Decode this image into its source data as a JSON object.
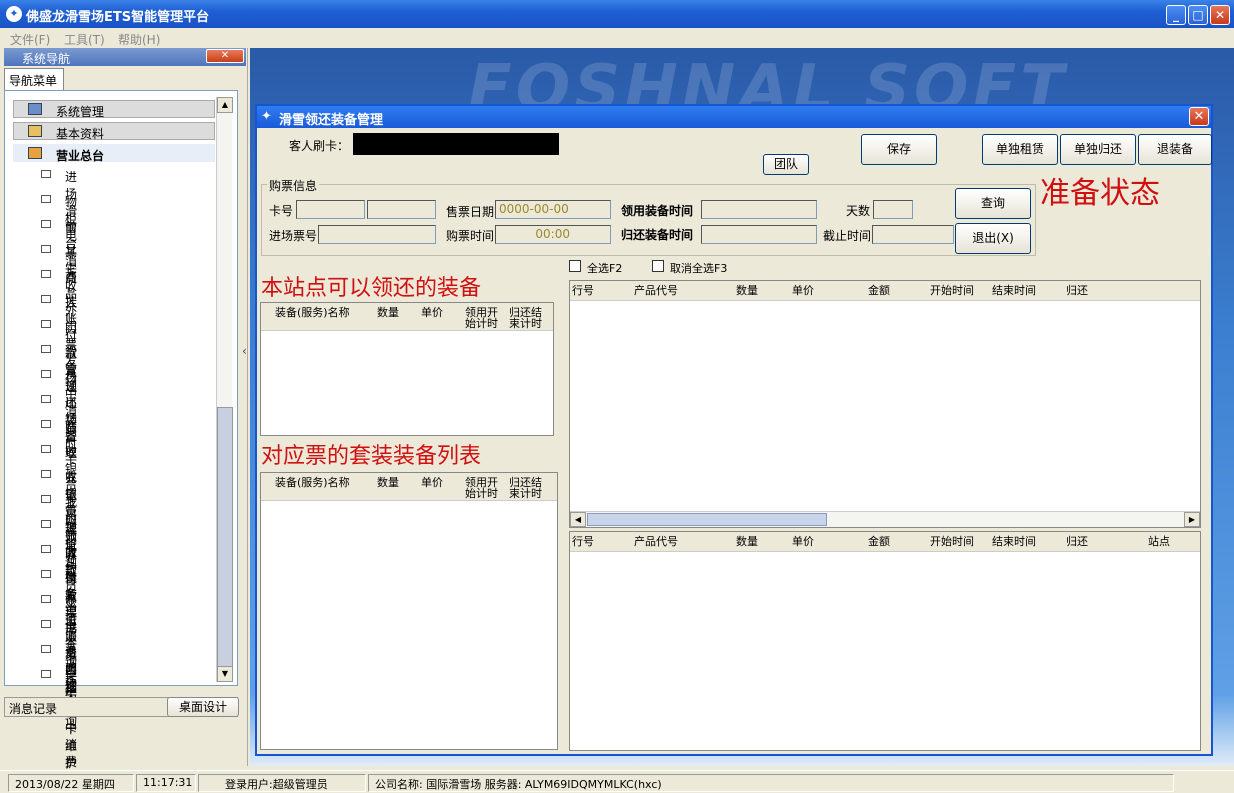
{
  "window": {
    "title": "佛盛龙滑雪场ETS智能管理平台"
  },
  "menu": [
    "文件(F)",
    "工具(T)",
    "帮助(H)"
  ],
  "nav": {
    "header": "系统导航",
    "tab": "导航菜单",
    "groups": [
      "系统管理",
      "基本资料",
      "营业总台"
    ],
    "items": [
      "进场滑雪",
      "物柜电子卡",
      "前台消费",
      "其它收入",
      "商品外卖",
      "挂账付款管理",
      "门票发行",
      "滑雪领还装备",
      "场中消费",
      "出场管理",
      "临时卡充值管理",
      "收银员上班预收款",
      "收银员上班预付款",
      "我的账务",
      "装备互换管理",
      "收银员交班账务审核",
      "账务单据查询",
      "账务消费明细查询",
      "电子卡挂失补卡维护",
      "退票管理",
      "未结场中消费调整"
    ],
    "msg_tab": "消息记录",
    "desk_btn": "桌面设计"
  },
  "dialog": {
    "title": "滑雪领还装备管理",
    "card_label": "客人刷卡：",
    "buttons": {
      "save": "保存",
      "team": "团队",
      "rent": "单独租赁",
      "return": "单独归还",
      "refund": "退装备",
      "query": "查询",
      "exit": "退出(X)"
    },
    "state_note": "准备状态",
    "ticket": {
      "legend": "购票信息",
      "card_no": "卡号",
      "sale_date": "售票日期",
      "sale_date_val": "0000-00-00",
      "take_time": "领用装备时间",
      "days": "天数",
      "entry_no": "进场票号",
      "buy_time": "购票时间",
      "buy_time_val": "00:00",
      "return_time": "归还装备时间",
      "end_time": "截止时间"
    },
    "note1": "本站点可以领还的装备",
    "note2": "对应票的套装装备列表",
    "equip_cols": [
      "装备(服务)名称",
      "数量",
      "单价",
      "领用开始计时",
      "归还结束计时"
    ],
    "select_all": "全选F2",
    "deselect_all": "取消全选F3",
    "top_cols": [
      "行号",
      "产品代号",
      "数量",
      "单价",
      "金额",
      "开始时间",
      "结束时间",
      "归还"
    ],
    "bottom_cols": [
      "行号",
      "产品代号",
      "数量",
      "单价",
      "金额",
      "开始时间",
      "结束时间",
      "归还",
      "站点"
    ]
  },
  "status": {
    "date": "2013/08/22 星期四",
    "time": "11:17:31",
    "user": "登录用户:超级管理员",
    "company": "公司名称: 国际滑雪场 服务器: ALYM69IDQMYMLKC(hxc)"
  },
  "watermark": "FOSHNAL SOFT"
}
